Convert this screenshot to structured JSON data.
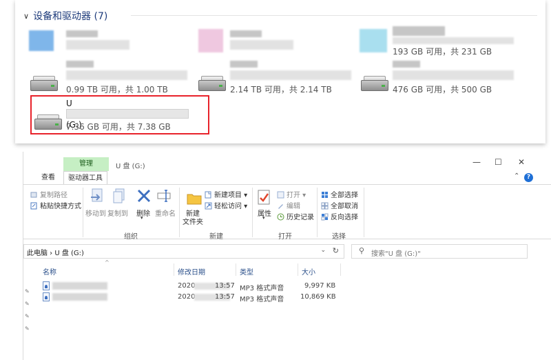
{
  "drives_section": {
    "title": "设备和驱动器 (7)",
    "drives": [
      {
        "capacity": "0.99 TB 可用，共 1.00 TB"
      },
      {
        "capacity": "2.14 TB 可用，共 2.14 TB"
      },
      {
        "capacity": "476 GB 可用，共 500 GB"
      },
      {
        "capacity": "193 GB 可用，共 231 GB"
      }
    ],
    "usb": {
      "name": "U 盘 (G:)",
      "capacity": "7.36 GB 可用，共 7.38 GB"
    }
  },
  "explorer": {
    "manage_tab": "管理",
    "window_title": "U 盘 (G:)",
    "controls": {
      "minimize": "—",
      "maximize": "☐",
      "close": "✕"
    },
    "ribbon_tabs": {
      "view": "查看",
      "drive_tools": "驱动器工具"
    },
    "ribbon": {
      "copy_path": "复制路径",
      "paste_shortcut": "粘贴快捷方式",
      "move_to": "移动到",
      "copy_to": "复制到",
      "delete": "删除",
      "rename": "重命名",
      "new_folder_line1": "新建",
      "new_folder_line2": "文件夹",
      "new_item": "新建项目 ▾",
      "easy_access": "轻松访问 ▾",
      "properties": "属性",
      "open": "打开 ▾",
      "edit": "编辑",
      "history": "历史记录",
      "select_all": "全部选择",
      "select_none": "全部取消",
      "invert_selection": "反向选择",
      "groups": {
        "organize": "组织",
        "new": "新建",
        "open": "打开",
        "select": "选择"
      }
    },
    "address": {
      "crumb": "此电脑  ›  U 盘 (G:)",
      "dropdown": "⌄",
      "refresh": "↻"
    },
    "search": {
      "placeholder": "搜索\"U 盘 (G:)\""
    },
    "columns": {
      "name": "名称",
      "date": "修改日期",
      "type": "类型",
      "size": "大小"
    },
    "files": [
      {
        "date_prefix": "2020",
        "time": "13:57",
        "type": "MP3 格式声音",
        "size": "9,997 KB"
      },
      {
        "date_prefix": "2020",
        "time": "13:57",
        "type": "MP3 格式声音",
        "size": "10,869 KB"
      }
    ]
  },
  "colors": {
    "accent": "#1c3a7a",
    "highlight": "#e8222a",
    "manage_tab": "#c6efc4"
  }
}
